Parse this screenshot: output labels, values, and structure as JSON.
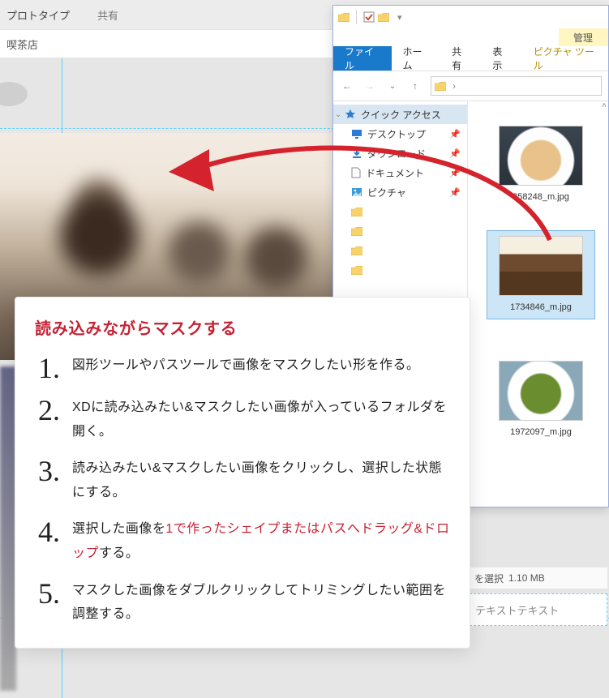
{
  "xd": {
    "tabs": {
      "prototype": "プロトタイプ",
      "share": "共有"
    },
    "artboard_title": "喫茶店",
    "placeholder_text": "テキストテキスト",
    "status": {
      "select_label": "を選択",
      "size": "1.10 MB"
    }
  },
  "explorer": {
    "ribbon": {
      "file": "ファイル",
      "home": "ホーム",
      "share": "共有",
      "view": "表示",
      "manage": "管理",
      "picture_tool": "ピクチャ ツール"
    },
    "nav": {
      "quick": "クイック アクセス",
      "desktop": "デスクトップ",
      "downloads": "ダウンロード",
      "documents": "ドキュメント",
      "pictures": "ピクチャ"
    },
    "files": {
      "f1": "358248_m.jpg",
      "f2": "1734846_m.jpg",
      "f3": "1972097_m.jpg"
    }
  },
  "card": {
    "title": "読み込みながらマスクする",
    "steps": {
      "s1": "図形ツールやパスツールで画像をマスクしたい形を作る。",
      "s2": "XDに読み込みたい&マスクしたい画像が入っているフォルダを開く。",
      "s3": "読み込みたい&マスクしたい画像をクリックし、選択した状態にする。",
      "s4a": "選択した画像を",
      "s4b": "1で作ったシェイプまたはパスへドラッグ&ドロップ",
      "s4c": "する。",
      "s5": "マスクした画像をダブルクリックしてトリミングしたい範囲を調整する。"
    },
    "nums": {
      "n1": "1.",
      "n2": "2.",
      "n3": "3.",
      "n4": "4.",
      "n5": "5."
    }
  }
}
